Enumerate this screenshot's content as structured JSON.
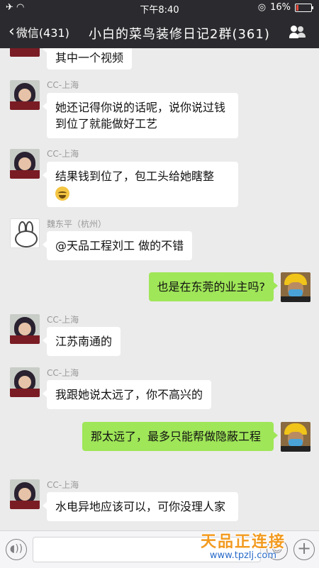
{
  "status_bar": {
    "time": "下午8:40",
    "battery": "16%",
    "battery_level": 0.16
  },
  "nav": {
    "back_label": "微信(431)",
    "title": "小白的菜鸟装修日记2群(361)"
  },
  "messages": [
    {
      "side": "in",
      "sender": "",
      "text": "其中一个视频"
    },
    {
      "side": "in",
      "sender": "CC-上海",
      "text": "她还记得你说的话呢，说你说过钱到位了就能做好工艺"
    },
    {
      "side": "in",
      "sender": "CC-上海",
      "text": "结果钱到位了，包工头给她瞎整"
    },
    {
      "side": "in",
      "sender": "魏东平（杭州）",
      "text": "@天品工程刘工 做的不错"
    },
    {
      "side": "out",
      "sender": "",
      "text": "也是在东莞的业主吗?"
    },
    {
      "side": "in",
      "sender": "CC-上海",
      "text": "江苏南通的"
    },
    {
      "side": "in",
      "sender": "CC-上海",
      "text": "我跟她说太远了，你不高兴的"
    },
    {
      "side": "out",
      "sender": "",
      "text": "那太远了，最多只能帮做隐蔽工程"
    },
    {
      "side": "in",
      "sender": "CC-上海",
      "text": "水电异地应该可以，可你没理人家"
    }
  ],
  "icons": {
    "back": "chevron-left-icon",
    "group": "group-members-icon",
    "voice": "voice-icon",
    "emoji": "emoji-icon",
    "plus": "plus-icon"
  },
  "watermark": {
    "name": "天品正连接",
    "url": "www.tpzlj.com"
  },
  "colors": {
    "nav_bg": "#2b2b2f",
    "chat_bg": "#ebebeb",
    "outgoing_bubble": "#9fe658",
    "incoming_bubble": "#ffffff",
    "watermark": "#f29a1f"
  }
}
